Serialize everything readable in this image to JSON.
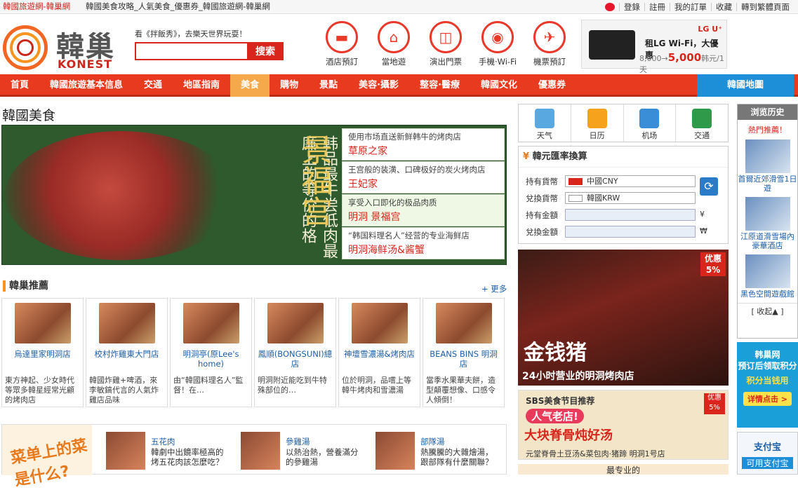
{
  "topbar": {
    "site": "韓國旅遊網-韓巢網",
    "page_title": "韓國美食攻略_人氣美食_優惠券_韓國旅遊網-韓巢網",
    "links": [
      "登錄",
      "註冊",
      "我的訂單",
      "收藏",
      "轉到繁體頁面"
    ]
  },
  "logo": {
    "cn": "韓巢",
    "en": "KONEST"
  },
  "search": {
    "hint": "看《拌飯秀》，去樂天世界玩耍！",
    "placeholder": "",
    "button": "搜索"
  },
  "quick_icons": [
    {
      "label": "酒店預訂",
      "icon": "bed-icon",
      "glyph": "▬"
    },
    {
      "label": "當地遊",
      "icon": "landmark-icon",
      "glyph": "⌂"
    },
    {
      "label": "演出門票",
      "icon": "stage-icon",
      "glyph": "◫"
    },
    {
      "label": "手機·Wi-Fi",
      "icon": "wifi-icon",
      "glyph": "◉"
    },
    {
      "label": "機票預訂",
      "icon": "plane-icon",
      "glyph": "✈"
    }
  ],
  "header_ad": {
    "brand": "LG U⁺",
    "line1": "租LG Wi-Fi，大優惠",
    "old_price": "8,000→",
    "new_price": "5,000",
    "unit": "韩元/1天"
  },
  "nav": [
    "首頁",
    "韓國旅遊基本信息",
    "交通",
    "地區指南",
    "美食",
    "購物",
    "景點",
    "美容·攝影",
    "整容·醫療",
    "韓國文化",
    "優惠券",
    "韓國地圖"
  ],
  "nav_active_index": 4,
  "page_heading": "韓國美食",
  "banner": {
    "slogan": "韩品最牛尝低肉最廉上的等价的格",
    "brand": "景福宫",
    "items": [
      {
        "desc": "使用市场直送新鲜韩牛的烤肉店",
        "name": "草原之家"
      },
      {
        "desc": "王宫般的装潢、口碑极好的炭火烤肉店",
        "name": "王妃家"
      },
      {
        "desc": "享受入口即化的极品肉质",
        "name": "明洞 景福宫"
      },
      {
        "desc": "“韩国料理名人”经营的专业海鲜店",
        "name": "明洞海鲜汤&酱蟹"
      }
    ]
  },
  "recommend": {
    "title": "韓巢推薦",
    "more": "+ 更多",
    "cards": [
      {
        "name": "烏達里家明洞店",
        "desc": "東方神起、少女時代等眾多韓星經常光顧的烤肉店"
      },
      {
        "name": "校村炸雞東大門店",
        "desc": "韓國炸雞+啤酒，來李敏鎬代言的人氣炸雞店品味"
      },
      {
        "name": "明洞亭(原Lee's home)",
        "desc": "由“韓國料理名人”監督！在…"
      },
      {
        "name": "鳳順(BONGSUNI)總店",
        "desc": "明洞附近能吃到牛特殊部位的…"
      },
      {
        "name": "神壇雪濃湯&烤肉店",
        "desc": "位於明洞，品嚐上等韓牛烤肉和雪濃湯"
      },
      {
        "name": "BEANS BINS 明洞店",
        "desc": "當季水果華夫餅，造型顛覆想像、口感令人傾倒！"
      }
    ]
  },
  "bottom": {
    "promo": "菜单上的菜是什么?",
    "items": [
      {
        "title": "五花肉",
        "desc": "韓劇中出鏡率極高的烤五花肉該怎麼吃？"
      },
      {
        "title": "參雞湯",
        "desc": "以熱治熱，營養滿分的參雞湯"
      },
      {
        "title": "部隊湯",
        "desc": "熱騰騰的大雜燴湯，跟部隊有什麼關聯？"
      }
    ]
  },
  "tools": [
    {
      "label": "天气",
      "icon": "weather-icon",
      "color": "#5aa8e0"
    },
    {
      "label": "日历",
      "icon": "calendar-icon",
      "color": "#f7a21d"
    },
    {
      "label": "机场",
      "icon": "airport-icon",
      "color": "#3a8ed8"
    },
    {
      "label": "交通",
      "icon": "subway-icon",
      "color": "#2e9a4a"
    }
  ],
  "fx": {
    "title": "韓元匯率換算",
    "have_label": "持有貨幣",
    "have_value": "中國CNY",
    "to_label": "兌換貨幣",
    "to_value": "韓國KRW",
    "amount_label": "持有金額",
    "amount_unit": "¥",
    "converted_label": "兌換金額",
    "converted_unit": "₩"
  },
  "ad_big": {
    "tag": "优惠5%",
    "title": "金钱猪",
    "subtitle": "24小时营业的明洞烤肉店"
  },
  "ad_sbs": {
    "line1": "SBS美食节目推荐",
    "badge": "人气老店!",
    "title": "大块脊骨炖好汤",
    "sub": "元堂脊骨土豆汤&菜包肉·猪蹄 明洞1号店",
    "tag": "优惠5%"
  },
  "ad_bottom": "最专业的",
  "history": {
    "title": "浏览历史",
    "hot": "熱門推薦！",
    "items": [
      "首爾近郊滑雪1日遊",
      "江原道滑雪場內豪華酒店",
      "黑色空間遊戲館"
    ],
    "collapse": "[ 收起▲ ]"
  },
  "side_ad1": {
    "line1": "韩巢网",
    "line2": "预订后领取积分",
    "line3": "积分当钱用",
    "button": "详情点击 >"
  },
  "side_ad2": {
    "line1": "支付宝",
    "line2": "可用支付宝"
  }
}
